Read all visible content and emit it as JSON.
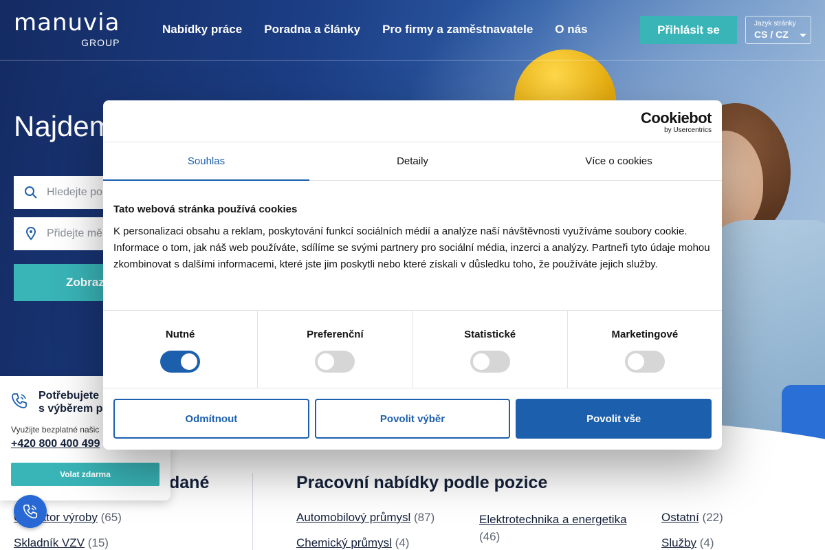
{
  "header": {
    "logo_brand": "manuvia",
    "logo_group": "GROUP",
    "nav": [
      "Nabídky práce",
      "Poradna a články",
      "Pro firmy a zaměstnavatele",
      "O nás"
    ],
    "login_label": "Přihlásit se",
    "language_label": "Jazyk stránky",
    "language_value": "CS / CZ"
  },
  "hero": {
    "title": "Najdem",
    "search_placeholder": "Hledejte po",
    "location_placeholder": "Přidejte mě",
    "show_button": "Zobraz"
  },
  "cookie": {
    "brand": "Cookiebot",
    "brand_sub": "by Usercentrics",
    "tabs": [
      "Souhlas",
      "Detaily",
      "Více o cookies"
    ],
    "active_tab": "Souhlas",
    "title": "Tato webová stránka používá cookies",
    "body": "K personalizaci obsahu a reklam, poskytování funkcí sociálních médií a analýze naší návštěvnosti využíváme soubory cookie. Informace o tom, jak náš web používáte, sdílíme se svými partnery pro sociální média, inzerci a analýzy. Partneři tyto údaje mohou zkombinovat s dalšími informacemi, které jste jim poskytli nebo které získali v důsledku toho, že používáte jejich služby.",
    "categories": [
      {
        "label": "Nutné",
        "enabled": true
      },
      {
        "label": "Preferenční",
        "enabled": false
      },
      {
        "label": "Statistické",
        "enabled": false
      },
      {
        "label": "Marketingové",
        "enabled": false
      }
    ],
    "buttons": {
      "reject": "Odmítnout",
      "allow_selection": "Povolit výběr",
      "allow_all": "Povolit vše"
    }
  },
  "call_widget": {
    "title_line1": "Potřebujete",
    "title_line2": "s výběrem p",
    "subtitle": "Využijte bezplatné našic",
    "phone": "+420 800 400 499",
    "button": "Volat zdarma"
  },
  "lower": {
    "left_title": "dané",
    "left_jobs": [
      {
        "name": "Operátor výroby",
        "count": "(65)"
      },
      {
        "name": "Skladník VZV",
        "count": "(15)"
      }
    ],
    "right_title": "Pracovní nabídky podle pozice",
    "right_jobs": [
      {
        "name": "Automobilový průmysl",
        "count": "(87)"
      },
      {
        "name": "Chemický průmysl",
        "count": "(4)"
      },
      {
        "name": "Elektrotechnika a energetika",
        "count": "(46)"
      },
      {
        "name": "Ostatní",
        "count": "(22)"
      },
      {
        "name": "Služby",
        "count": "(4)"
      }
    ]
  },
  "colors": {
    "teal": "#39b4b7",
    "cookie_blue": "#1b5fad",
    "fab_blue": "#2768d4"
  }
}
